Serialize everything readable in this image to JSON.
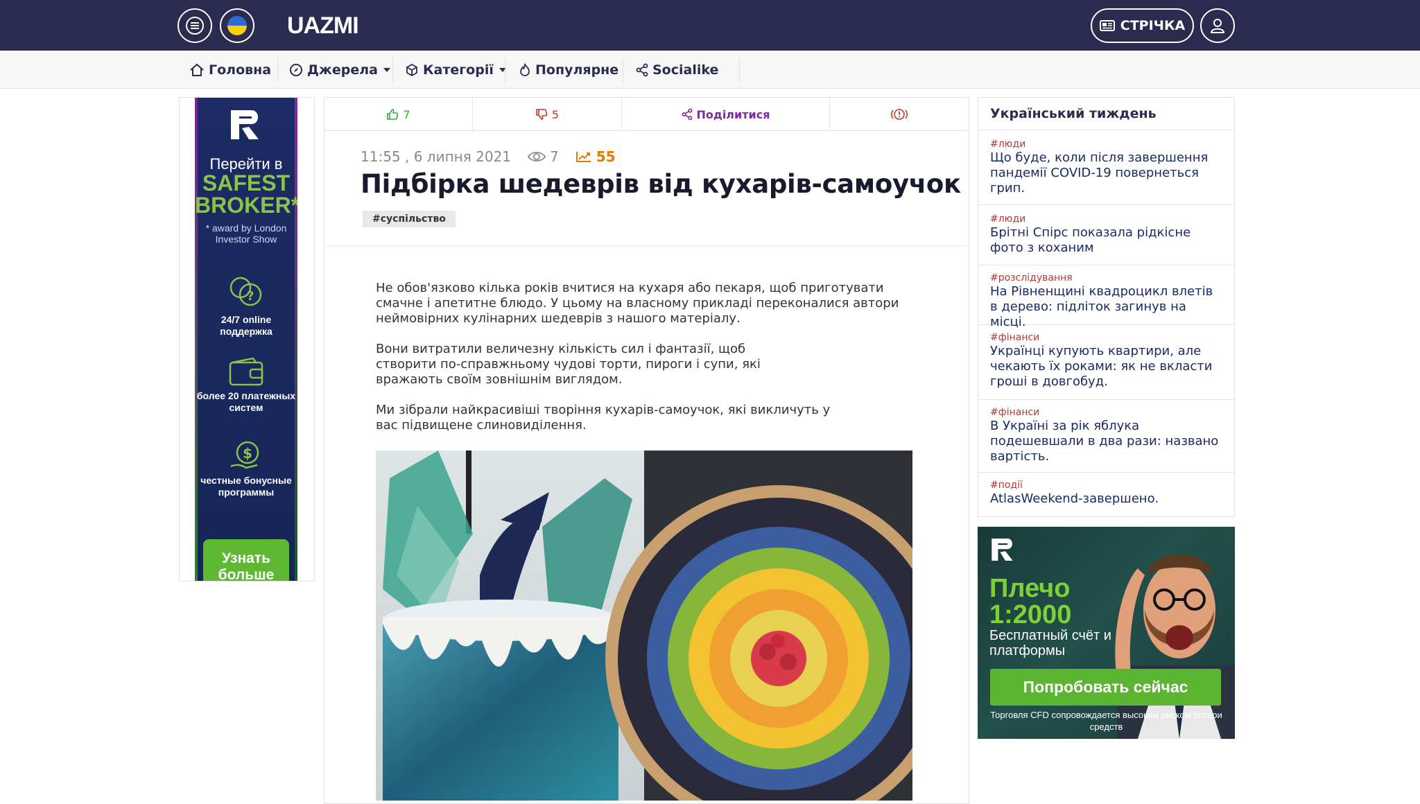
{
  "header": {
    "logo_text": "UAZMI",
    "strichka_label": "СТРІЧКА",
    "icons": [
      "menu-icon",
      "ukraine-flag-icon",
      "newspaper-icon",
      "user-icon"
    ]
  },
  "nav": {
    "items": [
      {
        "label": "Головна",
        "icon": "home-icon"
      },
      {
        "label": "Джерела",
        "icon": "compass-icon"
      },
      {
        "label": "Категорії",
        "icon": "cube-icon"
      },
      {
        "label": "Популярне",
        "icon": "fire-icon"
      },
      {
        "label": "Socialike",
        "icon": "share-icon"
      }
    ]
  },
  "left_ad": {
    "logo": "R",
    "line1": "Перейти в",
    "line2": "SAFEST",
    "line3": "BROKER*",
    "award": "* award by London Investor Show",
    "feature1": "24/7 online поддержка",
    "feature2": "более 20 платежных систем",
    "feature3": "честные бонусные программы",
    "cta": "Узнать больше"
  },
  "article": {
    "likes": "7",
    "dislikes": "5",
    "share_label": "Поділитися",
    "time": "11:55 , 6 липня 2021",
    "views": "7",
    "trend": "55",
    "title": "Підбірка шедеврів від кухарів-самоучок",
    "tag": "#суспільство",
    "paragraphs": [
      "Не обов'язково кілька років вчитися на кухаря або пекаря, щоб приготувати смачне і апетитне блюдо. У цьому на власному прикладі переконалися автори неймовірних кулінарних шедеврів з нашого матеріалу.",
      "Вони витратили величезну кількість сил і фантазії, щоб створити по-справжньому чудові торти, пироги і супи, які вражають своїм зовнішнім виглядом.",
      "Ми зібрали найкрасивіші творіння кухарів-самоучок, які викличуть у вас підвищене слиновиділення."
    ],
    "colors": {
      "like": "#3aa83a",
      "dislike": "#c0392b",
      "share": "#7b2c9c",
      "report": "#c0392b",
      "trend": "#e07b00"
    }
  },
  "sidebar": {
    "title": "Український тиждень",
    "items": [
      {
        "tag": "#люди",
        "text": "Що буде, коли після завершення пандемії COVID-19 повернеться грип."
      },
      {
        "tag": "#люди",
        "text": "Брітні Спірс показала рідкісне фото з коханим"
      },
      {
        "tag": "#розслідування",
        "text": "На Рівненщині квадроцикл влетів в дерево: підліток загинув на місці."
      },
      {
        "tag": "#фінанси",
        "text": "Українці купують квартири, але чекають їх роками: як не вкласти гроші в довгобуд."
      },
      {
        "tag": "#фінанси",
        "text": "В Україні за рік яблука подешевшали в два рази: названо вартість."
      },
      {
        "tag": "#події",
        "text": "AtlasWeekend-завершено."
      }
    ]
  },
  "right_ad": {
    "logo": "R",
    "leverage": "Плечо 1:2000",
    "free": "Бесплатный счёт и платформы",
    "cta": "Попробовать сейчас",
    "risk": "Торговля CFD сопровождается высоким риском потери средств"
  }
}
